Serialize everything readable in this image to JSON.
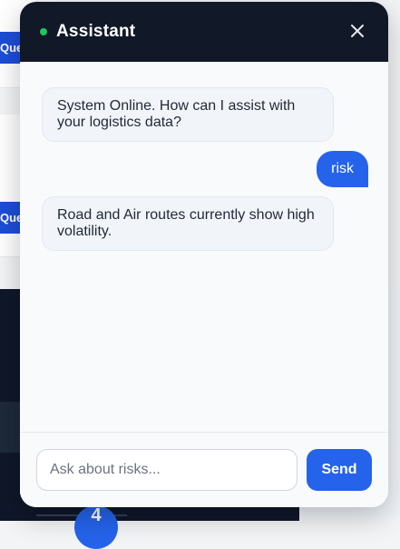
{
  "background": {
    "button_1_label": "Query",
    "button_2_label": "Query",
    "badge_number": "4"
  },
  "assistant": {
    "title": "Assistant",
    "status_color": "#22c55e",
    "close_icon": "close-icon",
    "messages": [
      {
        "role": "assistant",
        "text": "System Online. How can I assist with your logistics data?"
      },
      {
        "role": "user",
        "text": "risk"
      },
      {
        "role": "assistant",
        "text": "Road and Air routes currently show high volatility."
      }
    ],
    "input": {
      "placeholder": "Ask about risks...",
      "value": ""
    },
    "send_label": "Send"
  }
}
